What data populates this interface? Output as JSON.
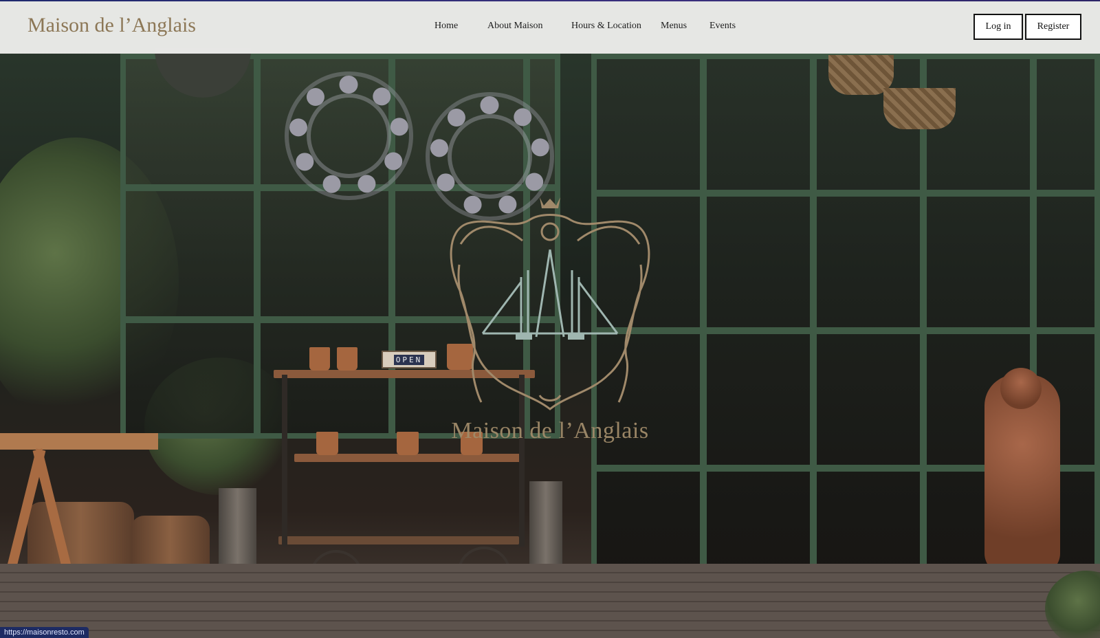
{
  "brand": {
    "logo_text": "Maison de l’Anglais",
    "crest_text": "Maison de l’Anglais"
  },
  "nav": {
    "items": [
      {
        "label": "Home"
      },
      {
        "label": "About Maison"
      },
      {
        "label": "Hours & Location"
      },
      {
        "label": "Menus"
      },
      {
        "label": "Events"
      }
    ]
  },
  "auth": {
    "login_label": "Log in",
    "register_label": "Register"
  },
  "hero": {
    "sign_text": "OPEN"
  },
  "status_bar": {
    "url": "https://maisonresto.com"
  },
  "colors": {
    "brand_gold": "#8c7756",
    "crest_gold": "#a08b6a",
    "window_green": "#3f5a45",
    "status_blue": "#1d2b63"
  }
}
